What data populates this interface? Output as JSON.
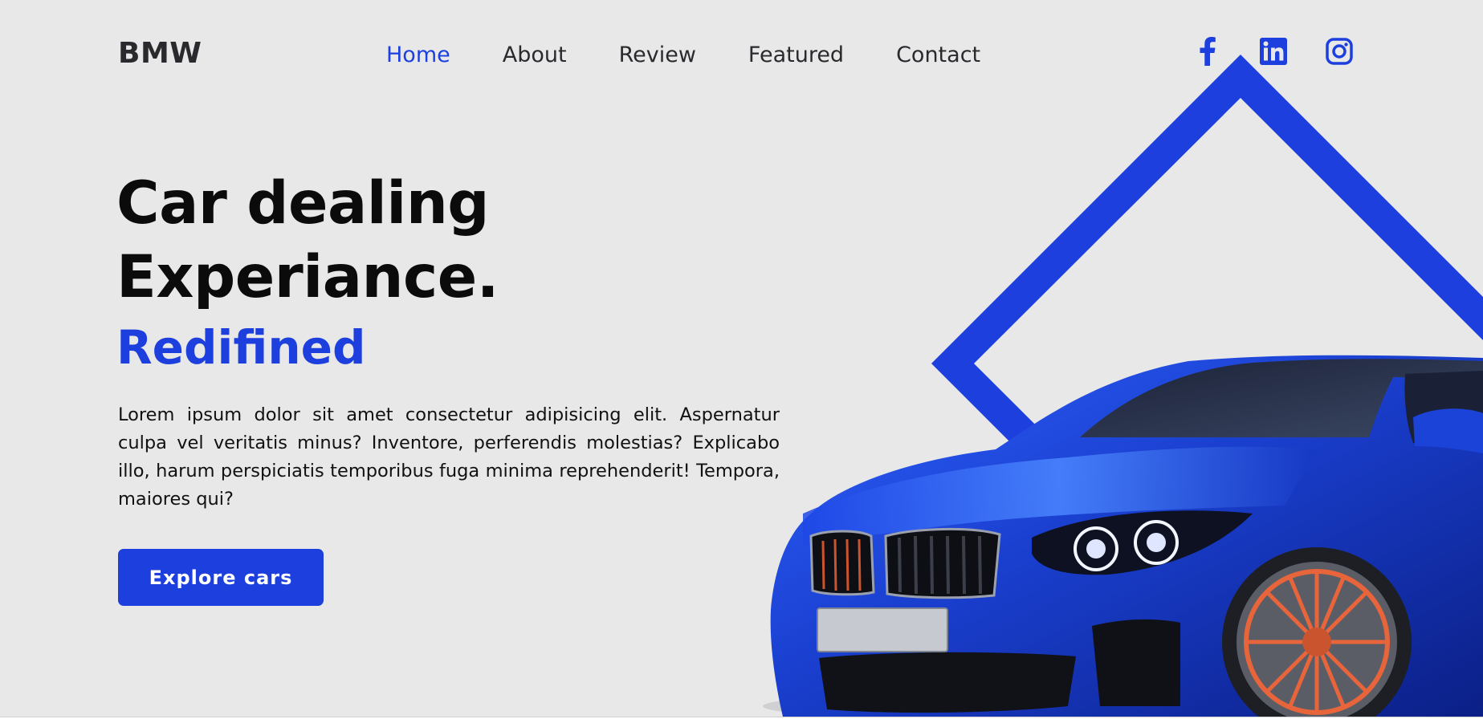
{
  "header": {
    "logo": "BMW",
    "nav": [
      {
        "label": "Home",
        "active": true
      },
      {
        "label": "About",
        "active": false
      },
      {
        "label": "Review",
        "active": false
      },
      {
        "label": "Featured",
        "active": false
      },
      {
        "label": "Contact",
        "active": false
      }
    ],
    "social": [
      {
        "icon": "facebook-icon"
      },
      {
        "icon": "linkedin-icon"
      },
      {
        "icon": "instagram-icon"
      }
    ]
  },
  "hero": {
    "headline_line1": "Car dealing",
    "headline_line2": "Experiance.",
    "accent": "Redifined",
    "description": "Lorem ipsum dolor sit amet consectetur adipisicing elit. Aspernatur culpa vel veritatis minus? Inventore, perferendis molestias? Explicabo illo, harum perspiciatis temporibus fuga minima reprehenderit! Tempora, maiores qui?",
    "cta_label": "Explore cars"
  },
  "colors": {
    "accent": "#1c3fdd",
    "background": "#e9e8e9",
    "text": "#0b0b0c"
  }
}
